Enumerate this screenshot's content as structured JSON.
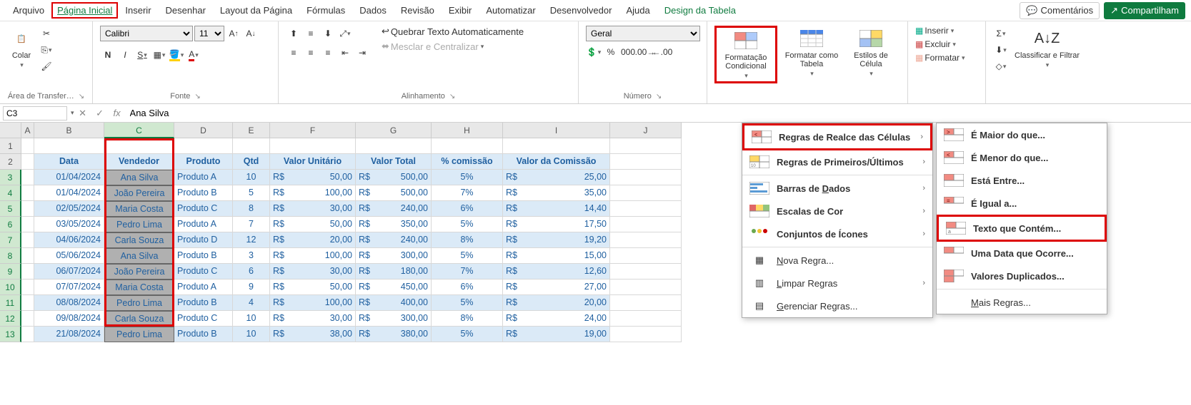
{
  "menubar": {
    "items": [
      "Arquivo",
      "Página Inicial",
      "Inserir",
      "Desenhar",
      "Layout da Página",
      "Fórmulas",
      "Dados",
      "Revisão",
      "Exibir",
      "Automatizar",
      "Desenvolvedor",
      "Ajuda",
      "Design da Tabela"
    ],
    "active": "Página Inicial",
    "comentarios": "Comentários",
    "compartilhar": "Compartilham"
  },
  "ribbon": {
    "clipboard": {
      "colar": "Colar",
      "label": "Área de Transfer…"
    },
    "fonte": {
      "font": "Calibri",
      "size": "11",
      "label": "Fonte"
    },
    "alinhamento": {
      "quebrar": "Quebrar Texto Automaticamente",
      "mesclar": "Mesclar e Centralizar",
      "label": "Alinhamento"
    },
    "numero": {
      "format": "Geral",
      "label": "Número"
    },
    "estilos": {
      "formatacao": "Formatação Condicional",
      "formatar_tabela": "Formatar como Tabela",
      "estilos_celula": "Estilos de Célula"
    },
    "celulas": {
      "inserir": "Inserir",
      "excluir": "Excluir",
      "formatar": "Formatar"
    },
    "edicao": {
      "classificar": "Classificar e Filtrar"
    }
  },
  "formula_bar": {
    "cell_ref": "C3",
    "formula": "Ana Silva"
  },
  "grid": {
    "col_letters": [
      "A",
      "B",
      "C",
      "D",
      "E",
      "F",
      "G",
      "H",
      "I",
      "J"
    ],
    "row_numbers": [
      1,
      2,
      3,
      4,
      5,
      6,
      7,
      8,
      9,
      10,
      11,
      12,
      13
    ],
    "headers": [
      "Data",
      "Vendedor",
      "Produto",
      "Qtd",
      "Valor Unitário",
      "Valor Total",
      "% comissão",
      "Valor da Comissão"
    ],
    "rows": [
      {
        "data": "01/04/2024",
        "vendedor": "Ana Silva",
        "produto": "Produto A",
        "qtd": "10",
        "vu_cur": "R$",
        "vu": "50,00",
        "vt_cur": "R$",
        "vt": "500,00",
        "com": "5%",
        "vc_cur": "R$",
        "vc": "25,00"
      },
      {
        "data": "01/04/2024",
        "vendedor": "João Pereira",
        "produto": "Produto B",
        "qtd": "5",
        "vu_cur": "R$",
        "vu": "100,00",
        "vt_cur": "R$",
        "vt": "500,00",
        "com": "7%",
        "vc_cur": "R$",
        "vc": "35,00"
      },
      {
        "data": "02/05/2024",
        "vendedor": "Maria Costa",
        "produto": "Produto C",
        "qtd": "8",
        "vu_cur": "R$",
        "vu": "30,00",
        "vt_cur": "R$",
        "vt": "240,00",
        "com": "6%",
        "vc_cur": "R$",
        "vc": "14,40"
      },
      {
        "data": "03/05/2024",
        "vendedor": "Pedro Lima",
        "produto": "Produto A",
        "qtd": "7",
        "vu_cur": "R$",
        "vu": "50,00",
        "vt_cur": "R$",
        "vt": "350,00",
        "com": "5%",
        "vc_cur": "R$",
        "vc": "17,50"
      },
      {
        "data": "04/06/2024",
        "vendedor": "Carla Souza",
        "produto": "Produto D",
        "qtd": "12",
        "vu_cur": "R$",
        "vu": "20,00",
        "vt_cur": "R$",
        "vt": "240,00",
        "com": "8%",
        "vc_cur": "R$",
        "vc": "19,20"
      },
      {
        "data": "05/06/2024",
        "vendedor": "Ana Silva",
        "produto": "Produto B",
        "qtd": "3",
        "vu_cur": "R$",
        "vu": "100,00",
        "vt_cur": "R$",
        "vt": "300,00",
        "com": "5%",
        "vc_cur": "R$",
        "vc": "15,00"
      },
      {
        "data": "06/07/2024",
        "vendedor": "João Pereira",
        "produto": "Produto C",
        "qtd": "6",
        "vu_cur": "R$",
        "vu": "30,00",
        "vt_cur": "R$",
        "vt": "180,00",
        "com": "7%",
        "vc_cur": "R$",
        "vc": "12,60"
      },
      {
        "data": "07/07/2024",
        "vendedor": "Maria Costa",
        "produto": "Produto A",
        "qtd": "9",
        "vu_cur": "R$",
        "vu": "50,00",
        "vt_cur": "R$",
        "vt": "450,00",
        "com": "6%",
        "vc_cur": "R$",
        "vc": "27,00"
      },
      {
        "data": "08/08/2024",
        "vendedor": "Pedro Lima",
        "produto": "Produto B",
        "qtd": "4",
        "vu_cur": "R$",
        "vu": "100,00",
        "vt_cur": "R$",
        "vt": "400,00",
        "com": "5%",
        "vc_cur": "R$",
        "vc": "20,00"
      },
      {
        "data": "09/08/2024",
        "vendedor": "Carla Souza",
        "produto": "Produto C",
        "qtd": "10",
        "vu_cur": "R$",
        "vu": "30,00",
        "vt_cur": "R$",
        "vt": "300,00",
        "com": "8%",
        "vc_cur": "R$",
        "vc": "24,00"
      },
      {
        "data": "21/08/2024",
        "vendedor": "Pedro Lima",
        "produto": "Produto B",
        "qtd": "10",
        "vu_cur": "R$",
        "vu": "38,00",
        "vt_cur": "R$",
        "vt": "380,00",
        "com": "5%",
        "vc_cur": "R$",
        "vc": "19,00"
      }
    ]
  },
  "menu1": {
    "realce": "Regras de Realce das Células",
    "primeiros": "Regras de Primeiros/Últimos",
    "barras": "Barras de Dados",
    "escalas": "Escalas de Cor",
    "icones": "Conjuntos de Ícones",
    "nova": "Nova Regra...",
    "limpar": "Limpar Regras",
    "gerenciar": "Gerenciar Regras..."
  },
  "menu2": {
    "maior": "É Maior do que...",
    "menor": "É Menor do que...",
    "entre": "Está Entre...",
    "igual": "É Igual a...",
    "texto": "Texto que Contém...",
    "data": "Uma Data que Ocorre...",
    "duplicados": "Valores Duplicados...",
    "mais": "Mais Regras..."
  }
}
